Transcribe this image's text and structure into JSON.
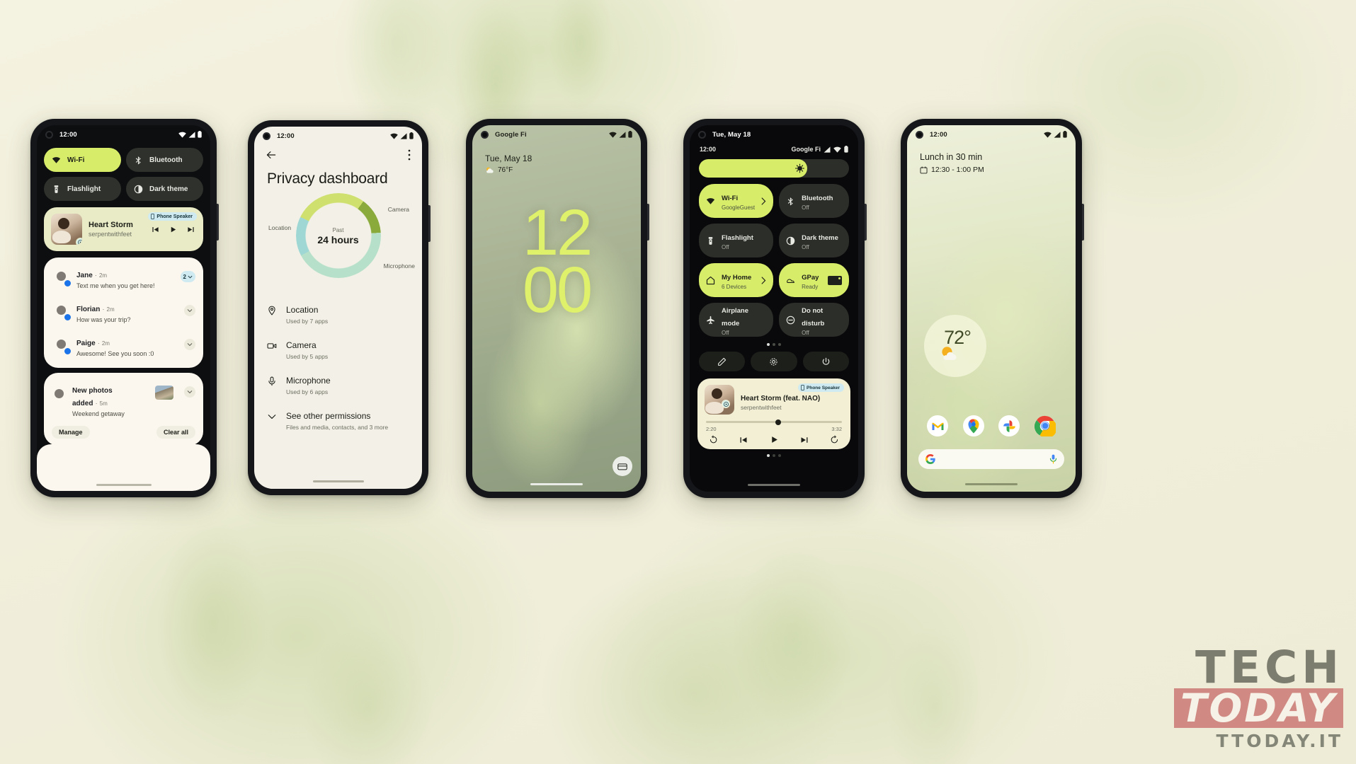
{
  "watermark": {
    "line1": "TECH",
    "line2": "TODAY",
    "line3": "TTODAY.IT"
  },
  "phone1": {
    "status": {
      "time": "12:00"
    },
    "tiles": [
      {
        "label": "Wi-Fi",
        "icon": "wifi-icon",
        "on": true
      },
      {
        "label": "Bluetooth",
        "icon": "bluetooth-icon",
        "on": false
      },
      {
        "label": "Flashlight",
        "icon": "flashlight-icon",
        "on": false
      },
      {
        "label": "Dark theme",
        "icon": "dark-theme-icon",
        "on": false
      }
    ],
    "media": {
      "title": "Heart Storm",
      "artist": "serpentwithfeet",
      "output_chip": "Phone Speaker"
    },
    "notifications": [
      {
        "name": "Jane",
        "time": "2m",
        "text": "Text me when you get here!",
        "count": "2"
      },
      {
        "name": "Florian",
        "time": "2m",
        "text": "How was your trip?"
      },
      {
        "name": "Paige",
        "time": "2m",
        "text": "Awesome! See you soon :0"
      }
    ],
    "photos_notification": {
      "name": "New photos added",
      "time": "5m",
      "text": "Weekend getaway"
    },
    "actions": {
      "manage": "Manage",
      "clear_all": "Clear all"
    }
  },
  "phone2": {
    "status": {
      "time": "12:00"
    },
    "title": "Privacy dashboard",
    "donut": {
      "past_label": "Past",
      "span_label": "24 hours"
    },
    "donut_labels": {
      "location": "Location",
      "camera": "Camera",
      "microphone": "Microphone"
    },
    "permissions": [
      {
        "name": "Location",
        "sub": "Used by 7 apps",
        "icon": "location-pin-icon"
      },
      {
        "name": "Camera",
        "sub": "Used by 5 apps",
        "icon": "camera-icon"
      },
      {
        "name": "Microphone",
        "sub": "Used by 6 apps",
        "icon": "microphone-icon"
      }
    ],
    "see_other": {
      "name": "See other permissions",
      "sub": "Files and media, contacts, and 3 more",
      "icon": "chevron-down-icon"
    }
  },
  "phone3": {
    "status": {
      "carrier": "Google Fi"
    },
    "date": "Tue, May 18",
    "temperature": "76°F",
    "clock_top": "12",
    "clock_bottom": "00"
  },
  "phone4": {
    "status": {
      "date": "Tue, May 18"
    },
    "qs_status": {
      "time": "12:00",
      "carrier": "Google Fi"
    },
    "tiles": [
      {
        "label": "Wi-Fi",
        "sub": "GoogleGuest",
        "icon": "wifi-icon",
        "on": true,
        "arrow": true
      },
      {
        "label": "Bluetooth",
        "sub": "Off",
        "icon": "bluetooth-icon",
        "on": false,
        "arrow": false
      },
      {
        "label": "Flashlight",
        "sub": "Off",
        "icon": "flashlight-icon",
        "on": false,
        "arrow": false
      },
      {
        "label": "Dark theme",
        "sub": "Off",
        "icon": "dark-theme-icon",
        "on": false,
        "arrow": false
      },
      {
        "label": "My Home",
        "sub": "6 Devices",
        "icon": "home-icon",
        "on": true,
        "arrow": true
      },
      {
        "label": "GPay",
        "sub": "Ready",
        "icon": "gpay-icon",
        "on": true,
        "arrow": false
      },
      {
        "label": "Airplane mode",
        "sub": "Off",
        "icon": "airplane-icon",
        "on": false,
        "arrow": false
      },
      {
        "label": "Do not disturb",
        "sub": "Off",
        "icon": "do-not-disturb-icon",
        "on": false,
        "arrow": false
      }
    ],
    "footer_buttons": [
      "edit-pencil-icon",
      "settings-gear-icon",
      "power-icon"
    ],
    "media": {
      "title": "Heart Storm (feat. NAO)",
      "artist": "serpentwithfeet",
      "output_chip": "Phone Speaker",
      "elapsed": "2:20",
      "duration": "3:32"
    }
  },
  "phone5": {
    "status": {
      "time": "12:00"
    },
    "glance_title": "Lunch in 30 min",
    "glance_time": "12:30 - 1:00 PM",
    "weather": {
      "temp": "72°"
    },
    "dock": [
      "gmail-icon",
      "maps-icon",
      "photos-icon",
      "chrome-icon"
    ],
    "search": {
      "left_icon": "google-g-icon",
      "right_icon": "microphone-icon"
    }
  }
}
